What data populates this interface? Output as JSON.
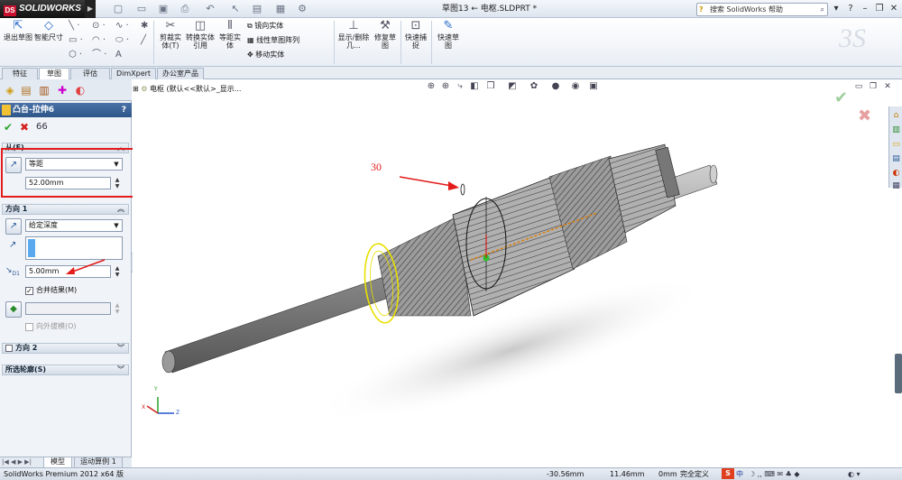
{
  "app": {
    "logo_text": "SOLIDWORKS",
    "logo_badge": "DS",
    "doc_title": "草图13 ← 电枢.SLDPRT *",
    "help_search": "搜索 SolidWorks 帮助",
    "icons": [
      "new-icon",
      "open-icon",
      "save-icon",
      "print-icon",
      "undo-icon",
      "select-icon",
      "rebuild-icon",
      "options-icon"
    ]
  },
  "ribbon": {
    "exit_sketch": "退出草图",
    "smart_dim": "智能尺寸",
    "trim": "剪裁实体(T)",
    "convert": "转换实体引用",
    "offset": "等距实体",
    "mirror": "镜向实体",
    "linear_pattern": "线性草图阵列",
    "move": "移动实体",
    "show_delete": "显示/删除几...",
    "repair": "修复草图",
    "quick_snap": "快速捕捉",
    "rapid_sketch": "快速草图"
  },
  "tabs": [
    "特征",
    "草图",
    "评估",
    "DimXpert",
    "办公室产品"
  ],
  "active_tab": "草图",
  "panel": {
    "title": "凸台-拉伸6",
    "help": "?",
    "from_label": "从(F)",
    "from_type": "等距",
    "from_value": "52.00mm",
    "dir1_label": "方向 1",
    "dir1_type": "给定深度",
    "depth_value": "5.00mm",
    "merge_label": "合并结果(M)",
    "draft_label": "向外拔模(O)",
    "dir2_label": "方向 2",
    "contours_label": "所选轮廓(S)"
  },
  "graphics": {
    "tree_label": "电枢 (默认<<默认>_显示...",
    "annotation_text": "30"
  },
  "bottom_tabs": [
    "模型",
    "运动算例 1"
  ],
  "status": {
    "product": "SolidWorks Premium 2012 x64 版",
    "x": "-30.56mm",
    "y": "11.46mm",
    "z": "0mm",
    "state": "完全定义",
    "ime": "中"
  },
  "colors": {
    "highlight_red": "#e31b1b",
    "accept_green": "#2fa62f",
    "cancel_red": "#d42020",
    "header_blue": "#3a63a0",
    "selection_yellow": "#e8e000"
  }
}
